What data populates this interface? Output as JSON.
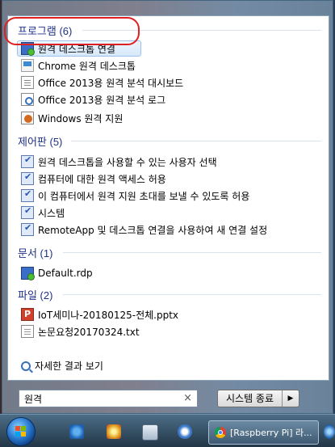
{
  "programs": {
    "header": "프로그램 (6)",
    "items": [
      {
        "label": "원격 데스크톱 연결",
        "icon": "remote-desktop-icon"
      },
      {
        "label": "Chrome 원격 데스크톱",
        "icon": "chrome-remote-desktop-icon"
      },
      {
        "label": "Office 2013용 원격 분석 대시보드",
        "icon": "telemetry-dashboard-icon"
      },
      {
        "label": "Office 2013용 원격 분석 로그",
        "icon": "telemetry-log-icon"
      },
      {
        "label": "Windows 원격 지원",
        "icon": "remote-assistance-icon"
      }
    ]
  },
  "control_panel": {
    "header": "제어판 (5)",
    "items": [
      {
        "label": "원격 데스크톱을 사용할 수 있는 사용자 선택",
        "icon": "control-panel-icon"
      },
      {
        "label": "컴퓨터에 대한 원격 액세스 허용",
        "icon": "control-panel-icon"
      },
      {
        "label": "이 컴퓨터에서 원격 지원 초대를 보낼 수 있도록 허용",
        "icon": "control-panel-icon"
      },
      {
        "label": "시스템",
        "icon": "control-panel-icon"
      },
      {
        "label": "RemoteApp 및 데스크톱 연결을 사용하여 새 연결 설정",
        "icon": "control-panel-icon"
      }
    ]
  },
  "documents": {
    "header": "문서 (1)",
    "items": [
      {
        "label": "Default.rdp",
        "icon": "rdp-file-icon"
      }
    ]
  },
  "files": {
    "header": "파일 (2)",
    "items": [
      {
        "label": "IoT세미나-20180125-전체.pptx",
        "icon": "powerpoint-file-icon"
      },
      {
        "label": "논문요청20170324.txt",
        "icon": "text-file-icon"
      }
    ]
  },
  "see_more": "자세한 결과 보기",
  "search": {
    "value": "원격",
    "clear": "×"
  },
  "shutdown": {
    "label": "시스템 종료",
    "arrow": "▶"
  },
  "taskbar": {
    "window_title": "[Raspberry Pi] 라..."
  },
  "colors": {
    "category_header": "#1e3287",
    "selection": "#d6e8fb",
    "highlight_circle": "#e02020"
  }
}
